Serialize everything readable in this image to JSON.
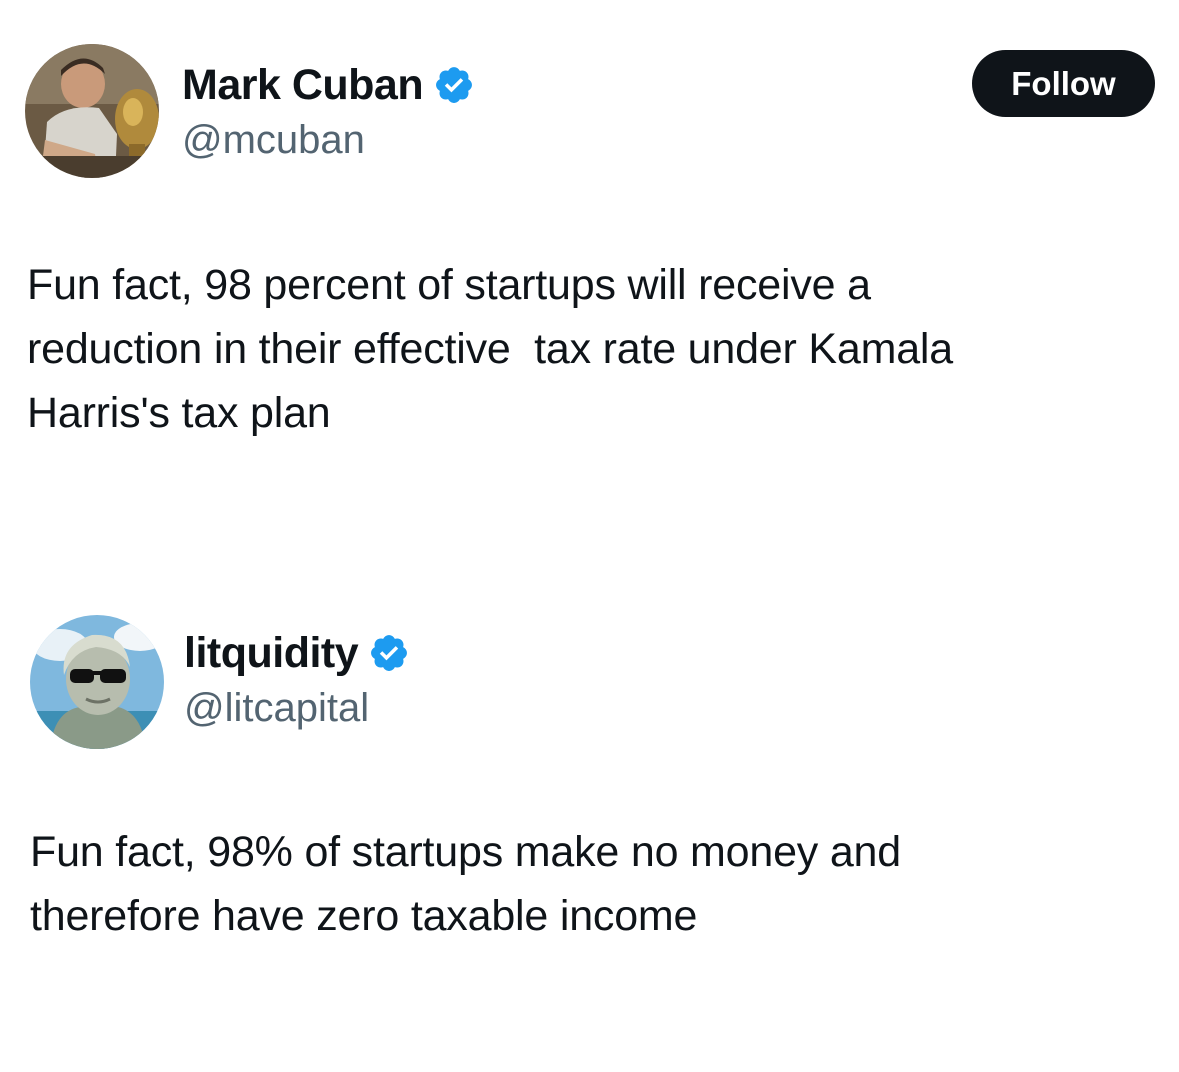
{
  "tweets": [
    {
      "display_name": "Mark Cuban",
      "handle": "@mcuban",
      "verified": true,
      "follow_label": "Follow",
      "text": "Fun fact, 98 percent of startups will receive a\nreduction in their effective  tax rate under Kamala\nHarris's tax plan"
    },
    {
      "display_name": "litquidity",
      "handle": "@litcapital",
      "verified": true,
      "text": "Fun fact, 98% of startups make no money and\ntherefore have zero taxable income"
    }
  ],
  "colors": {
    "verified_blue": "#1d9bf0",
    "follow_bg": "#0f1419",
    "handle_gray": "#536471"
  },
  "icons": {
    "verified": "verified-badge-icon"
  }
}
